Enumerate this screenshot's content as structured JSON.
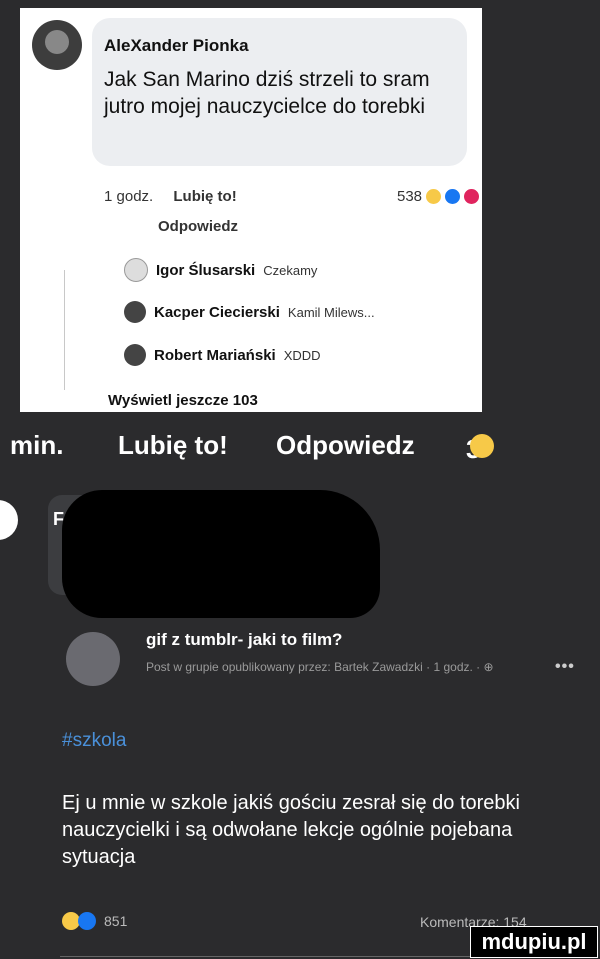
{
  "comment": {
    "author": "AleXander Pionka",
    "text": "Jak San Marino dziś strzeli to sram jutro mojej nauczycielce do torebki",
    "time": "1 godz.",
    "like_label": "Lubię to!",
    "reaction_count": "538",
    "reply_label": "Odpowiedz",
    "replies": [
      {
        "name": "Igor Ślusarski",
        "text": "Czekamy"
      },
      {
        "name": "Kacper Ciecierski",
        "text": "Kamil Milews..."
      },
      {
        "name": "Robert Mariański",
        "text": "XDDD"
      }
    ],
    "more_replies": "Wyświetl jeszcze 103"
  },
  "action_bar": {
    "time": "min.",
    "like_label": "Lubię to!",
    "reply_label": "Odpowiedz",
    "count": "3"
  },
  "faded_letter": "F",
  "post": {
    "title": "gif z tumblr- jaki to film?",
    "meta": "Post w grupie opublikowany przez: Bartek Zawadzki · 1 godz. · ",
    "hashtag": "#szkola",
    "body": "Ej u mnie w szkole jakiś gościu zesrał się do torebki nauczycielki i są odwołane lekcje ogólnie pojebana sytuacja",
    "reaction_count": "851",
    "comments_label": "Komentarze: 154"
  },
  "watermark": "mdupiu.pl",
  "colors": {
    "like_blue": "#1877f2",
    "haha_yellow": "#f7c948",
    "hashtag": "#4a90d9"
  }
}
